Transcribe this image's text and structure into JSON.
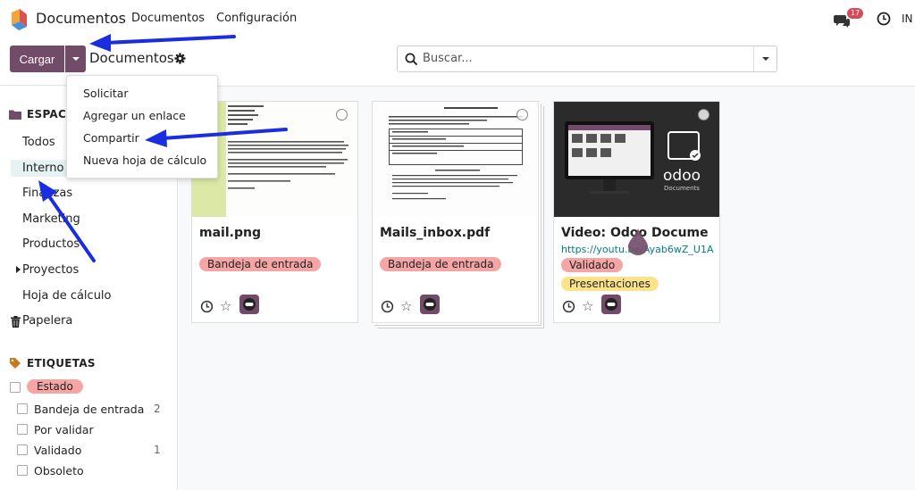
{
  "app": {
    "title": "Documentos"
  },
  "nav": {
    "menu_1": "Documentos",
    "menu_2": "Configuración",
    "chat_count": "17",
    "lang": "IN"
  },
  "toolbar": {
    "upload_label": "Cargar",
    "breadcrumb": "Documentos"
  },
  "search": {
    "placeholder": "Buscar..."
  },
  "dropdown": {
    "items": [
      "Solicitar",
      "Agregar un enlace",
      "Compartir",
      "Nueva hoja de cálculo"
    ]
  },
  "sidebar": {
    "workspaces_title": "ESPACIOS DE TRABAJO",
    "items": [
      "Todos",
      "Interno",
      "Finanzas",
      "Marketing",
      "Productos",
      "Proyectos",
      "Hoja de cálculo"
    ],
    "trash": "Papelera",
    "tags_title": "ETIQUETAS",
    "tag_group": "Estado",
    "tags": [
      {
        "label": "Bandeja de entrada",
        "count": "2"
      },
      {
        "label": "Por validar",
        "count": ""
      },
      {
        "label": "Validado",
        "count": "1"
      },
      {
        "label": "Obsoleto",
        "count": ""
      }
    ]
  },
  "cards": [
    {
      "title": "mail.png",
      "url": "",
      "tags": [
        "Bandeja de entrada"
      ]
    },
    {
      "title": "Mails_inbox.pdf",
      "url": "",
      "tags": [
        "Bandeja de entrada"
      ]
    },
    {
      "title": "Video: Odoo Documents",
      "url": "https://youtu.be/Ayab6wZ_U1A",
      "tags": [
        "Validado",
        "Presentaciones"
      ],
      "thumb_brand": "odoo",
      "thumb_caption": "Documents"
    }
  ],
  "colors": {
    "accent": "#714b67",
    "teal": "#017e84",
    "tag_red": "#f6a5a5",
    "tag_yellow": "#fbe38a",
    "arrow": "#1a2ee0"
  },
  "icons": [
    "app-logo-icon",
    "chat-icon",
    "clock-icon",
    "gear-icon",
    "search-icon",
    "folder-icon",
    "trash-icon",
    "tag-icon",
    "star-icon",
    "avatar-icon"
  ]
}
